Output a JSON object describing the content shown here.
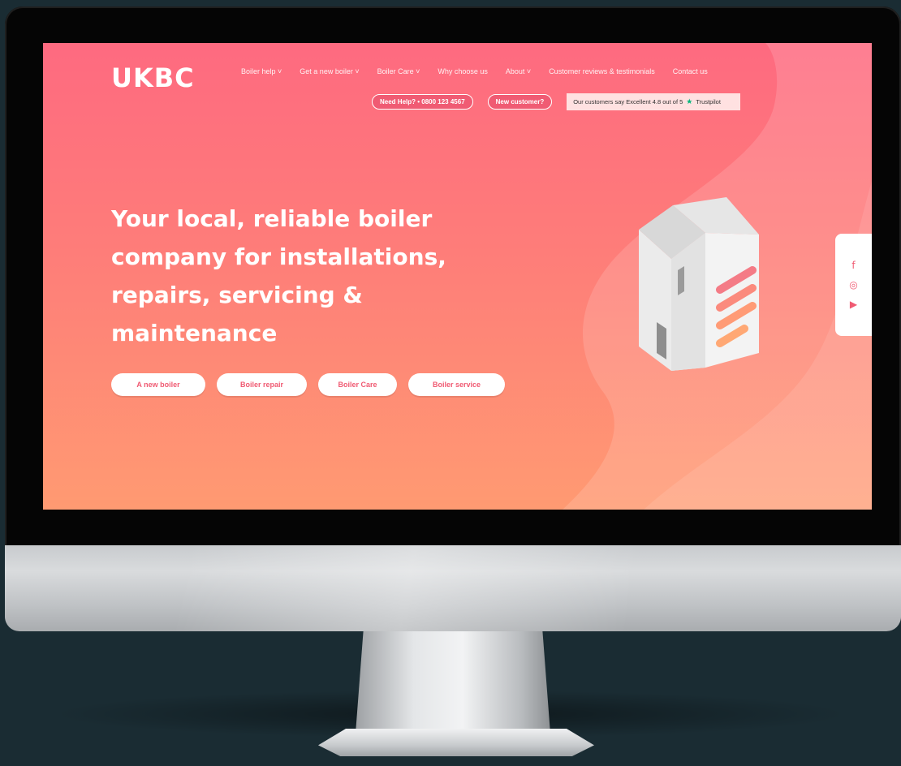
{
  "site": {
    "logo": "UKBC",
    "nav": [
      "Boiler help ˅",
      "Get a new boiler ˅",
      "Boiler Care ˅",
      "Why choose us",
      "About ˅",
      "Customer reviews & testimonials",
      "Contact us"
    ],
    "pills": [
      "Need Help? • 0800 123 4567",
      "New customer?"
    ],
    "trustpilot_text": "Our customers say Excellent 4.8 out of 5",
    "trustpilot_brand": "Trustpilot",
    "headline": "Your local, reliable boiler company for installations, repairs, servicing & maintenance",
    "cta": [
      "A new boiler",
      "Boiler repair",
      "Boiler Care",
      "Boiler service"
    ],
    "social_icons": [
      "facebook-icon",
      "instagram-icon",
      "youtube-icon"
    ]
  },
  "colors": {
    "brand_pink": "#f05b73",
    "gradient_top": "#fe6a80",
    "gradient_bottom": "#ff9a72",
    "trust_green": "#00b67a",
    "backdrop": "#1a2c33"
  }
}
